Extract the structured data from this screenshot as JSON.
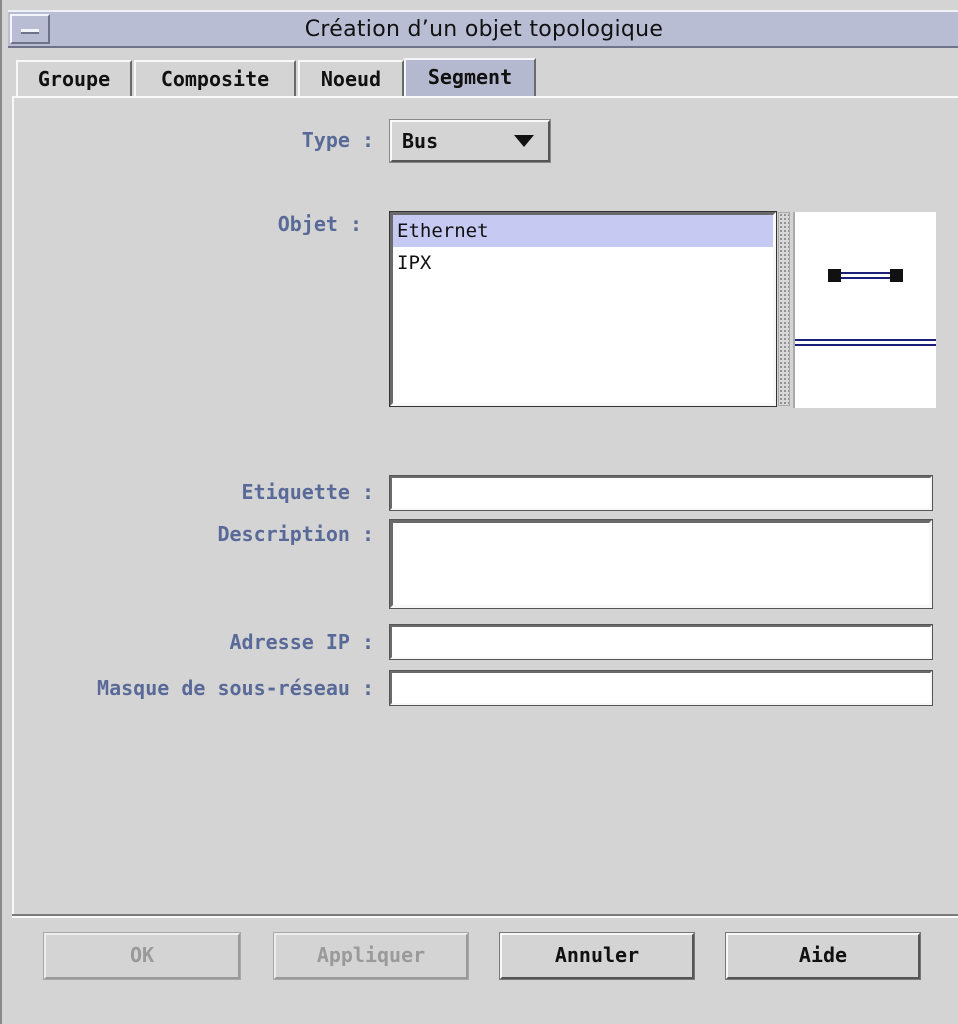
{
  "window": {
    "title": "Création d’un objet topologique"
  },
  "tabs": [
    {
      "label": "Groupe",
      "active": false
    },
    {
      "label": "Composite",
      "active": false
    },
    {
      "label": "Noeud",
      "active": false
    },
    {
      "label": "Segment",
      "active": true
    }
  ],
  "form": {
    "type_label": "Type :",
    "type_value": "Bus",
    "object_label": "Objet :",
    "objects": [
      {
        "label": "Ethernet",
        "selected": true
      },
      {
        "label": "IPX",
        "selected": false
      }
    ],
    "etiquette_label": "Etiquette :",
    "etiquette_value": "",
    "description_label": "Description :",
    "description_value": "",
    "ip_label": "Adresse IP :",
    "ip_value": "",
    "mask_label": "Masque de sous-réseau :",
    "mask_value": ""
  },
  "buttons": {
    "ok": "OK",
    "apply": "Appliquer",
    "cancel": "Annuler",
    "help": "Aide"
  },
  "colors": {
    "label": "#5a6a98",
    "active_tab": "#b5b9cf",
    "selection": "#c6c9f2",
    "preview_line": "#1c1f7a"
  }
}
